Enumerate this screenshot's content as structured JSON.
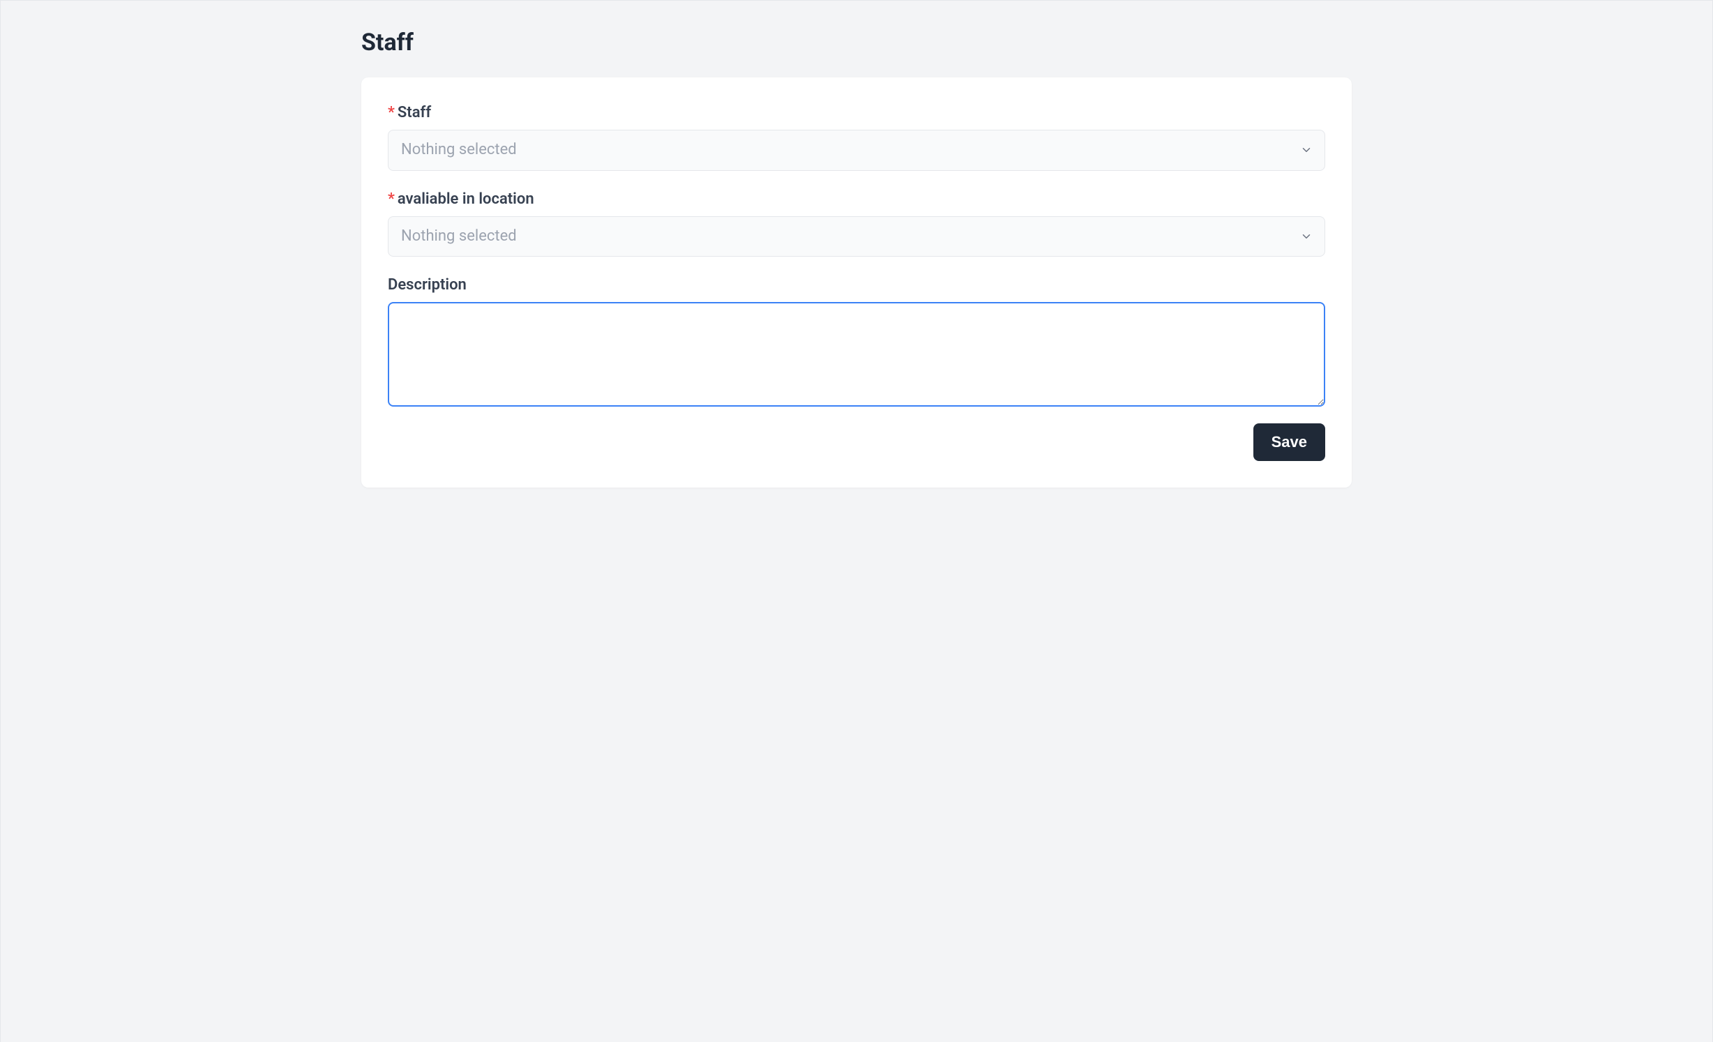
{
  "page": {
    "title": "Staff"
  },
  "form": {
    "staff": {
      "label": "Staff",
      "required_mark": "*",
      "placeholder": "Nothing selected",
      "value": ""
    },
    "location": {
      "label": "avaliable in location",
      "required_mark": "*",
      "placeholder": "Nothing selected",
      "value": ""
    },
    "description": {
      "label": "Description",
      "value": ""
    },
    "actions": {
      "save_label": "Save"
    }
  }
}
